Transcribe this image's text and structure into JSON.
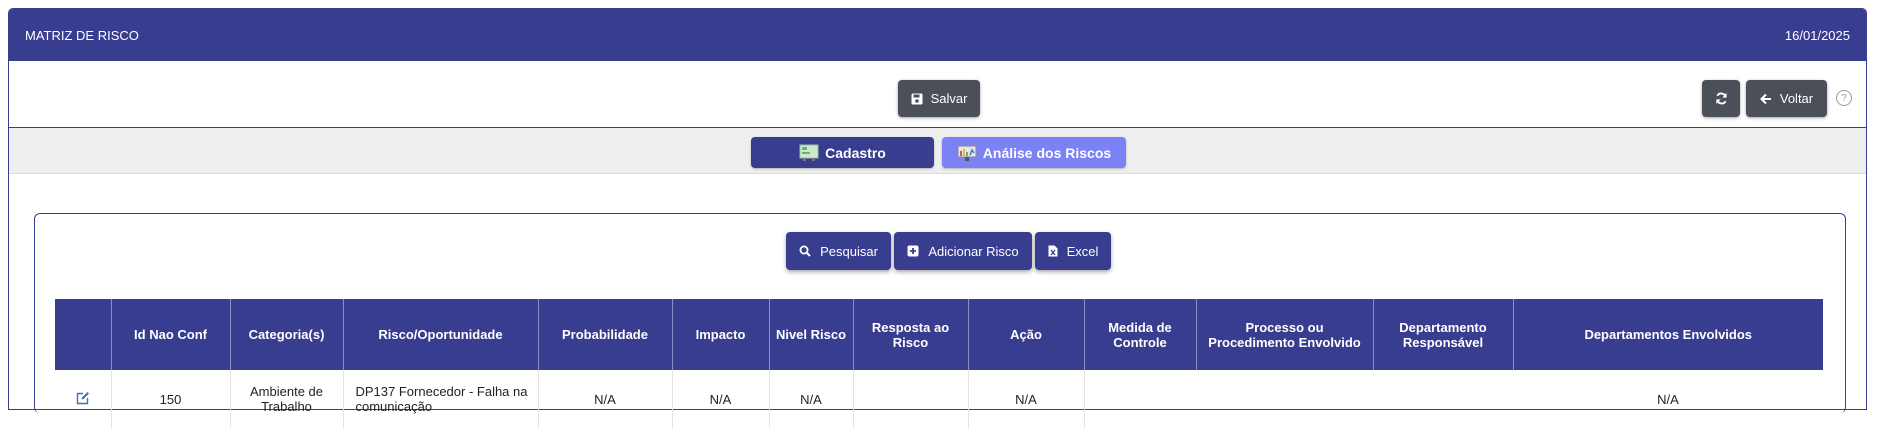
{
  "header": {
    "title": "MATRIZ DE RISCO",
    "date": "16/01/2025"
  },
  "toolbar": {
    "save_label": "Salvar",
    "refresh_icon": "refresh-icon",
    "back_label": "Voltar",
    "help_glyph": "?"
  },
  "tabs": [
    {
      "label": "Cadastro",
      "icon": "form-icon",
      "color": "#383d8f",
      "active": false
    },
    {
      "label": "Análise dos Riscos",
      "icon": "analysis-icon",
      "color": "#7b82f5",
      "active": true
    }
  ],
  "actions": {
    "search_label": "Pesquisar",
    "add_label": "Adicionar Risco",
    "excel_label": "Excel"
  },
  "table": {
    "headers": [
      "",
      "Id Nao Conf",
      "Categoria(s)",
      "Risco/Oportunidade",
      "Probabilidade",
      "Impacto",
      "Nivel Risco",
      "Resposta ao Risco",
      "Ação",
      "Medida de Controle",
      "Processo ou Procedimento Envolvido",
      "Departamento Responsável",
      "Departamentos Envolvidos"
    ],
    "rows": [
      {
        "id": "150",
        "categoria": "Ambiente de Trabalho",
        "risco": "DP137 Fornecedor - Falha na comunicação",
        "probabilidade": "N/A",
        "impacto": "N/A",
        "nivel": "N/A",
        "resposta": "",
        "acao": "N/A",
        "medida": "",
        "processo": "",
        "dep_resp": "",
        "deps_env": "N/A"
      }
    ]
  },
  "colors": {
    "primary": "#383d8f",
    "dark_button": "#4a4f58",
    "accent_tab": "#7b82f5"
  }
}
